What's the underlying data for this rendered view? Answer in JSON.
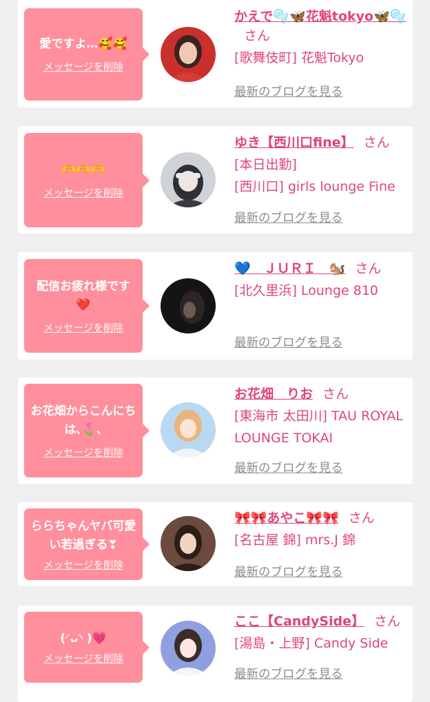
{
  "delete_label": "メッセージを削除",
  "blog_label": "最新のブログを見る",
  "san_label": "さん",
  "colors": {
    "bubble": "#ff8f9c",
    "name": "#e0457a",
    "link_gray": "#8c8c8c",
    "background": "#efefef"
  },
  "cards": [
    {
      "message": "愛ですよ…🥰🥰",
      "name": "かえで🫧🦋花魁tokyo🦋🫧",
      "shop_lines": [
        "[歌舞伎町] 花魁Tokyo"
      ]
    },
    {
      "message": "🫶🫶🫶",
      "name": "ゆき【西川口fine】",
      "shop_lines": [
        "[本日出勤]",
        "[西川口] girls lounge Fine"
      ]
    },
    {
      "message": "配信お疲れ様です❤️",
      "name": "💙　ＪＵＲＩ　🐿️",
      "shop_lines": [
        "[北久里浜] Lounge 810"
      ]
    },
    {
      "message": "お花畑からこんにちは､🌷､",
      "name": "お花畑　りお",
      "shop_lines": [
        "[東海市 太田川] TAU ROYAL LOUNGE TOKAI"
      ]
    },
    {
      "message": "ららちゃんヤバ可愛い若過ぎる❣",
      "name": "🎀🎀あやこ🎀🎀",
      "shop_lines": [
        "[名古屋 錦] mrs.J 錦"
      ]
    },
    {
      "message": "(◜ᴗ◝ )💗",
      "name": "ここ【CandySide】",
      "shop_lines": [
        "[湯島・上野] Candy Side"
      ]
    }
  ]
}
